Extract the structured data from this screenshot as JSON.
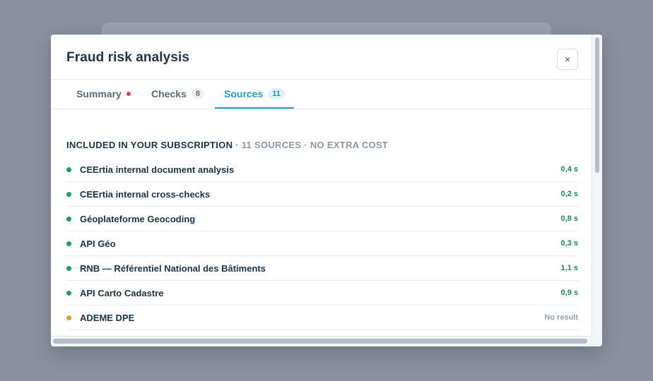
{
  "modal": {
    "title": "Fraud risk analysis",
    "close_label": "×"
  },
  "tabs": [
    {
      "label": "Summary",
      "has_alert_dot": true
    },
    {
      "label": "Checks",
      "count": "8"
    },
    {
      "label": "Sources",
      "count": "11",
      "active": true
    }
  ],
  "section": {
    "title": "INCLUDED IN YOUR SUBSCRIPTION",
    "meta": " · 11 SOURCES · NO EXTRA COST"
  },
  "sources": [
    {
      "name": "CEErtia internal document analysis",
      "time": "0,4 s",
      "status": "ok"
    },
    {
      "name": "CEErtia internal cross-checks",
      "time": "0,2 s",
      "status": "ok"
    },
    {
      "name": "Géoplateforme Geocoding",
      "time": "0,8 s",
      "status": "ok"
    },
    {
      "name": "API Géo",
      "time": "0,3 s",
      "status": "ok"
    },
    {
      "name": "RNB — Référentiel National des Bâtiments",
      "time": "1,1 s",
      "status": "ok"
    },
    {
      "name": "API Carto Cadastre",
      "time": "0,9 s",
      "status": "ok"
    },
    {
      "name": "ADEME DPE",
      "time": "No result",
      "status": "warn"
    }
  ],
  "colors": {
    "accent": "#1ea0b8",
    "ok": "#1f9d68",
    "warn": "#e0a030",
    "alert": "#e0453c"
  }
}
